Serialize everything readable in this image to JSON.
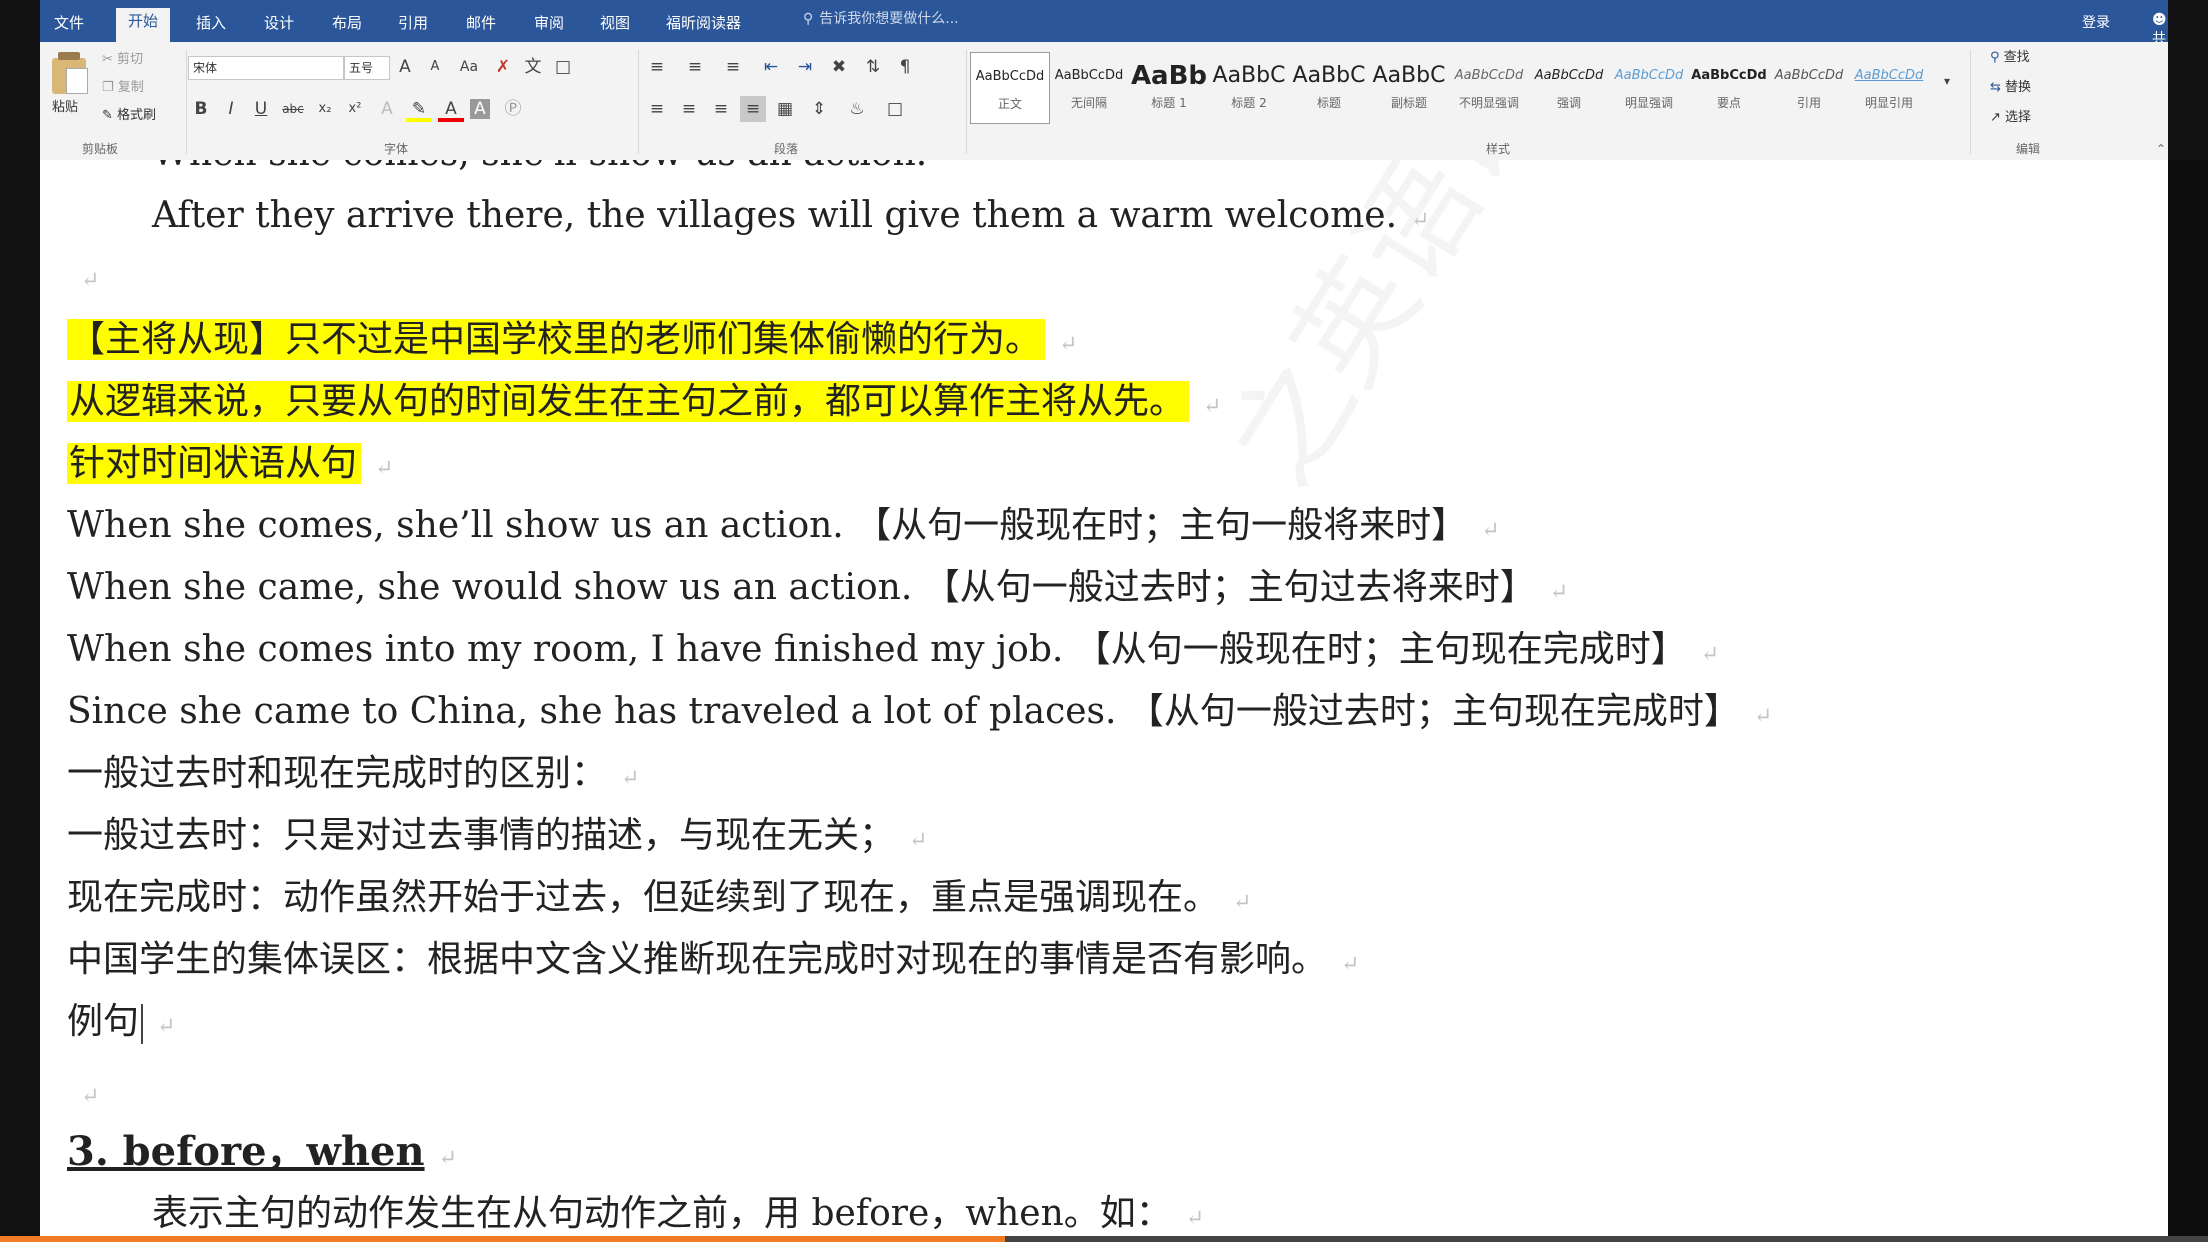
{
  "tabs": [
    {
      "label": "文件",
      "active": false
    },
    {
      "label": "开始",
      "active": true
    },
    {
      "label": "插入",
      "active": false
    },
    {
      "label": "设计",
      "active": false
    },
    {
      "label": "布局",
      "active": false
    },
    {
      "label": "引用",
      "active": false
    },
    {
      "label": "邮件",
      "active": false
    },
    {
      "label": "审阅",
      "active": false
    },
    {
      "label": "视图",
      "active": false
    },
    {
      "label": "福昕阅读器",
      "active": false
    }
  ],
  "tell_me": "告诉我你想要做什么...",
  "account": {
    "login": "登录",
    "share": "共享"
  },
  "ribbon": {
    "clipboard": {
      "paste": "粘贴",
      "cut": "剪切",
      "copy": "复制",
      "format_painter": "格式刷",
      "label": "剪贴板"
    },
    "font": {
      "name": "宋体",
      "size": "五号",
      "label": "字体"
    },
    "paragraph": {
      "label": "段落"
    },
    "styles": {
      "label": "样式",
      "items": [
        {
          "preview": "AaBbCcDd",
          "name": "正文",
          "selected": true
        },
        {
          "preview": "AaBbCcDd",
          "name": "无间隔",
          "selected": false
        },
        {
          "preview": "AaBb",
          "name": "标题 1",
          "selected": false
        },
        {
          "preview": "AaBbC",
          "name": "标题 2",
          "selected": false
        },
        {
          "preview": "AaBbC",
          "name": "标题",
          "selected": false
        },
        {
          "preview": "AaBbC",
          "name": "副标题",
          "selected": false
        },
        {
          "preview": "AaBbCcDd",
          "name": "不明显强调",
          "selected": false
        },
        {
          "preview": "AaBbCcDd",
          "name": "强调",
          "selected": false
        },
        {
          "preview": "AaBbCcDd",
          "name": "明显强调",
          "selected": false
        },
        {
          "preview": "AaBbCcDd",
          "name": "要点",
          "selected": false
        },
        {
          "preview": "AaBbCcDd",
          "name": "引用",
          "selected": false
        },
        {
          "preview": "AaBbCcDd",
          "name": "明显引用",
          "selected": false
        }
      ]
    },
    "editing": {
      "find": "查找",
      "replace": "替换",
      "select": "选择",
      "label": "编辑"
    }
  },
  "document": {
    "cut_line": "When she comes, she'll show us an action.",
    "lines": [
      "After they arrive there, the villages will give them a warm welcome.",
      "【主将从现】只不过是中国学校里的老师们集体偷懒的行为。",
      "从逻辑来说，只要从句的时间发生在主句之前，都可以算作主将从先。",
      "针对时间状语从句",
      "When she comes, she’ll show us an action. 【从句一般现在时；主句一般将来时】",
      "When she came, she would show us an action. 【从句一般过去时；主句过去将来时】",
      "When she comes into my room, I have finished my job. 【从句一般现在时；主句现在完成时】",
      "Since she came to China, she has traveled a lot of places. 【从句一般过去时；主句现在完成时】",
      "一般过去时和现在完成时的区别：",
      "一般过去时：只是对过去事情的描述，与现在无关；",
      "现在完成时：动作虽然开始于过去，但延续到了现在，重点是强调现在。",
      "中国学生的集体误区：根据中文含义推断现在完成时对现在的事情是否有影响。",
      "例句"
    ],
    "heading": "3. before，when",
    "last_line": "表示主句的动作发生在从句动作之前，用 before，when。如：",
    "watermark": "之英语语法进阶",
    "paragraph_mark": "↵",
    "highlight_color": "#fffd00"
  },
  "video": {
    "progress": 0.455,
    "progress_color": "#f07b22"
  }
}
